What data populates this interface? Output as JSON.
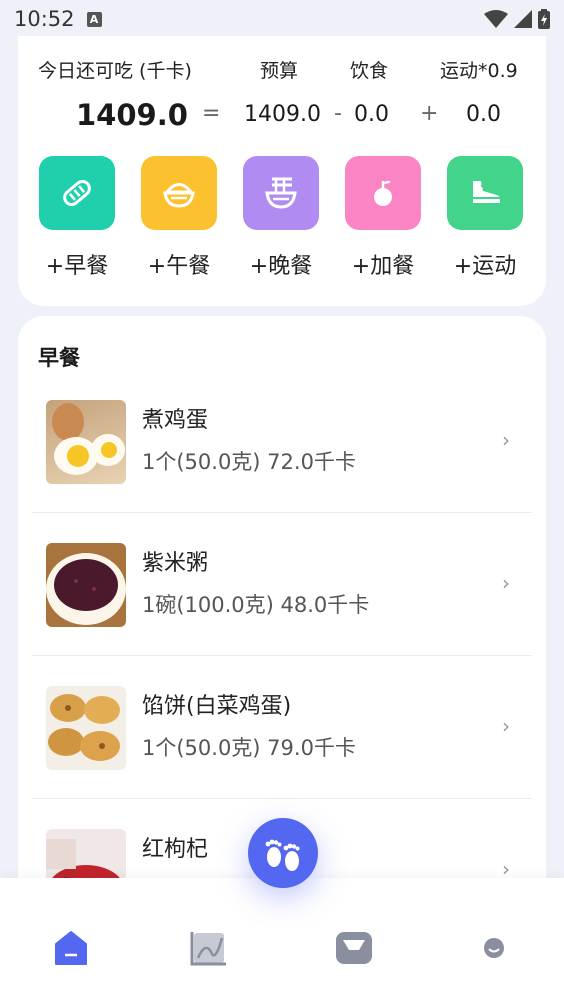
{
  "status": {
    "time": "10:52",
    "notice_icon": "A"
  },
  "summary": {
    "header": {
      "remaining_label": "今日还可吃 (千卡)",
      "budget_label": "预算",
      "diet_label": "饮食",
      "exercise_label": "运动*0.9"
    },
    "values": {
      "remaining": "1409.0",
      "eq": "=",
      "budget": "1409.0",
      "minus": "-",
      "diet": "0.0",
      "plus": "+",
      "exercise": "0.0"
    },
    "buttons": [
      {
        "label": "+早餐",
        "color": "#1fcfae",
        "icon": "bread-icon"
      },
      {
        "label": "+午餐",
        "color": "#fcc12e",
        "icon": "rice-bowl-icon"
      },
      {
        "label": "+晚餐",
        "color": "#b08cf2",
        "icon": "noodle-bowl-icon"
      },
      {
        "label": "+加餐",
        "color": "#fb84c4",
        "icon": "fruit-icon"
      },
      {
        "label": "+运动",
        "color": "#43d48b",
        "icon": "sneaker-icon"
      }
    ]
  },
  "list": {
    "title": "早餐",
    "items": [
      {
        "name": "煮鸡蛋",
        "detail": "1个(50.0克) 72.0千卡"
      },
      {
        "name": "紫米粥",
        "detail": "1碗(100.0克) 48.0千卡"
      },
      {
        "name": "馅饼(白菜鸡蛋)",
        "detail": "1个(50.0克) 79.0千卡"
      },
      {
        "name": "红枸杞",
        "detail": ""
      }
    ]
  },
  "fab_icon": "footprints-icon",
  "tabs": [
    {
      "icon": "home-icon",
      "active": true
    },
    {
      "icon": "chart-icon",
      "active": false
    },
    {
      "icon": "scale-icon",
      "active": false
    },
    {
      "icon": "profile-icon",
      "active": false
    }
  ],
  "colors": {
    "accent": "#5367f0",
    "inactive": "#8a8fa0"
  }
}
